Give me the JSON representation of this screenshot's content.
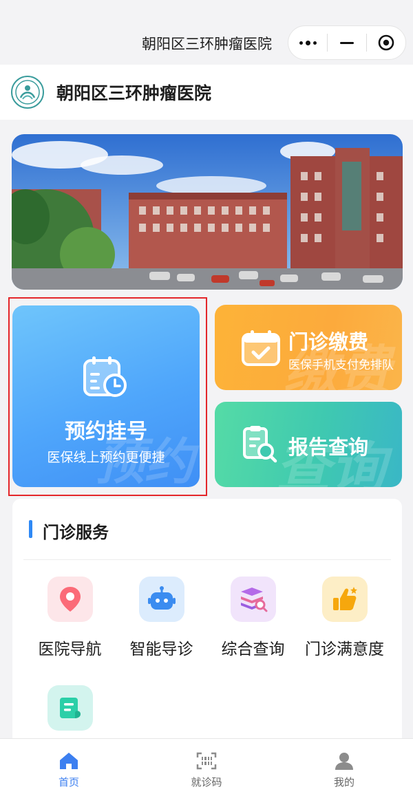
{
  "topbar": {
    "title": "朝阳区三环肿瘤医院",
    "capsule": {
      "more_icon": "more-dots-icon",
      "minimize_icon": "minus-icon",
      "close_icon": "target-icon"
    }
  },
  "header": {
    "title": "朝阳区三环肿瘤医院",
    "logo_icon": "hospital-logo"
  },
  "cards": {
    "registration": {
      "title": "预约挂号",
      "subtitle": "医保线上预约更便捷",
      "watermark": "预约",
      "icon": "calendar-clock-icon"
    },
    "payment": {
      "title": "门诊缴费",
      "subtitle": "医保手机支付免排队",
      "watermark": "缴费",
      "icon": "calendar-check-icon"
    },
    "report": {
      "title": "报告查询",
      "watermark": "查询",
      "icon": "report-search-icon"
    }
  },
  "service": {
    "title": "门诊服务",
    "items": [
      {
        "label": "医院导航",
        "icon": "location-pin-icon"
      },
      {
        "label": "智能导诊",
        "icon": "robot-icon"
      },
      {
        "label": "综合查询",
        "icon": "books-search-icon"
      },
      {
        "label": "门诊满意度",
        "icon": "thumbs-up-icon"
      },
      {
        "label": "",
        "icon": "scroll-document-icon"
      }
    ]
  },
  "tabbar": {
    "items": [
      {
        "label": "首页",
        "icon": "home-icon",
        "active": true
      },
      {
        "label": "就诊码",
        "icon": "scan-code-icon",
        "active": false
      },
      {
        "label": "我的",
        "icon": "user-icon",
        "active": false
      }
    ]
  },
  "colors": {
    "accent": "#3c7ff0",
    "registration_card": "#4fa6fb",
    "payment_card": "#fcaa3c",
    "report_card": "#3fc9b0",
    "highlight_border": "#e4262a"
  }
}
